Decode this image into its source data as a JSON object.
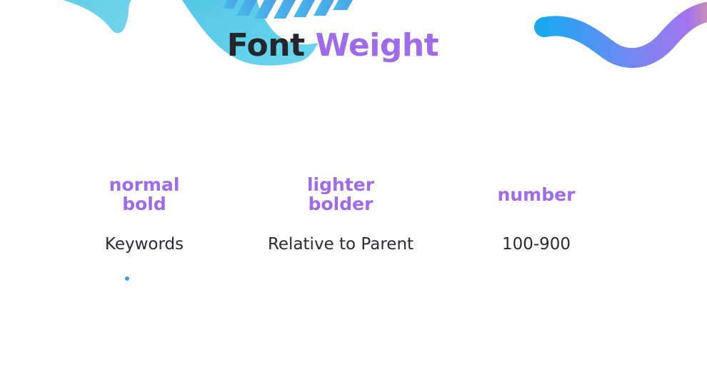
{
  "title": {
    "word1": "Font",
    "word2": "Weight"
  },
  "columns": [
    {
      "keywords": [
        "normal",
        "bold"
      ],
      "description": "Keywords"
    },
    {
      "keywords": [
        "lighter",
        "bolder"
      ],
      "description": "Relative to Parent"
    },
    {
      "keywords": [
        "number"
      ],
      "description": "100-900"
    }
  ],
  "colors": {
    "accent": "#a06bea",
    "text_dark": "#24262b",
    "wave_cyan": "#5fd0e6",
    "wave_blue": "#1aa7f0",
    "wave_purple": "#a374f0"
  },
  "icons": [
    "wave-decoration-left",
    "wave-decoration-right",
    "bullet-dot"
  ]
}
